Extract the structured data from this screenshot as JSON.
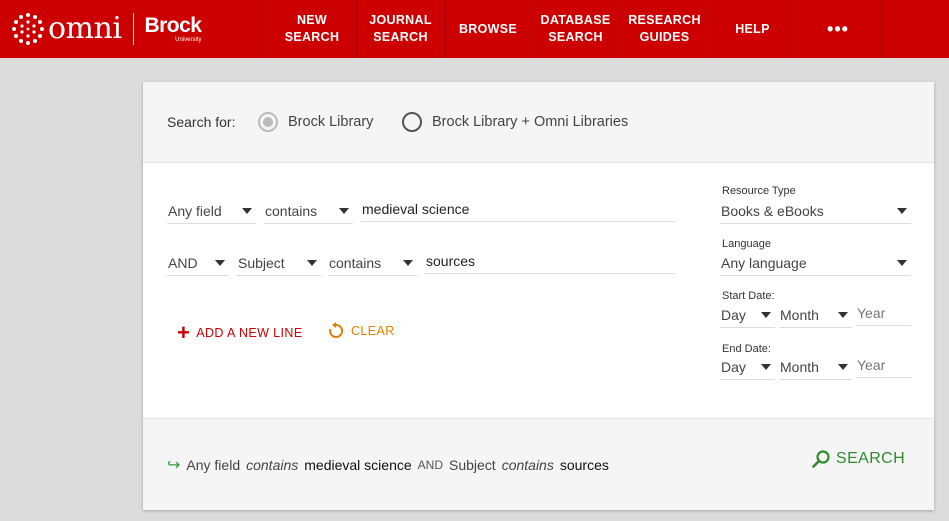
{
  "header": {
    "brand_name": "omni",
    "institution": "Brock",
    "institution_sub": "University",
    "nav": [
      {
        "label": "NEW\nSEARCH"
      },
      {
        "label": "JOURNAL\nSEARCH"
      },
      {
        "label": "BROWSE"
      },
      {
        "label": "DATABASE\nSEARCH"
      },
      {
        "label": "RESEARCH\nGUIDES"
      },
      {
        "label": "HELP"
      },
      {
        "label": "•••"
      }
    ]
  },
  "scope": {
    "label": "Search for:",
    "options": [
      {
        "label": "Brock Library",
        "selected": true
      },
      {
        "label": "Brock Library + Omni Libraries",
        "selected": false
      }
    ]
  },
  "query_lines": [
    {
      "boolean": "",
      "field": "Any field",
      "operator": "contains",
      "value": "medieval science"
    },
    {
      "boolean": "AND",
      "field": "Subject",
      "operator": "contains",
      "value": "sources"
    }
  ],
  "actions": {
    "add_line": "ADD A NEW LINE",
    "clear": "CLEAR"
  },
  "facets": {
    "resource_type": {
      "label": "Resource Type",
      "value": "Books & eBooks"
    },
    "language": {
      "label": "Language",
      "value": "Any language"
    },
    "start_date": {
      "label": "Start Date:",
      "day": "Day",
      "month": "Month",
      "year_placeholder": "Year"
    },
    "end_date": {
      "label": "End Date:",
      "day": "Day",
      "month": "Month",
      "year_placeholder": "Year"
    }
  },
  "summary": {
    "field1": "Any field",
    "op1": "contains",
    "term1": "medieval science",
    "boolean": "AND",
    "field2": "Subject",
    "op2": "contains",
    "term2": "sources",
    "search_label": "SEARCH"
  },
  "colors": {
    "header_red": "#cc0000",
    "accent_green": "#2f8a2f",
    "clear_orange": "#e08000"
  }
}
